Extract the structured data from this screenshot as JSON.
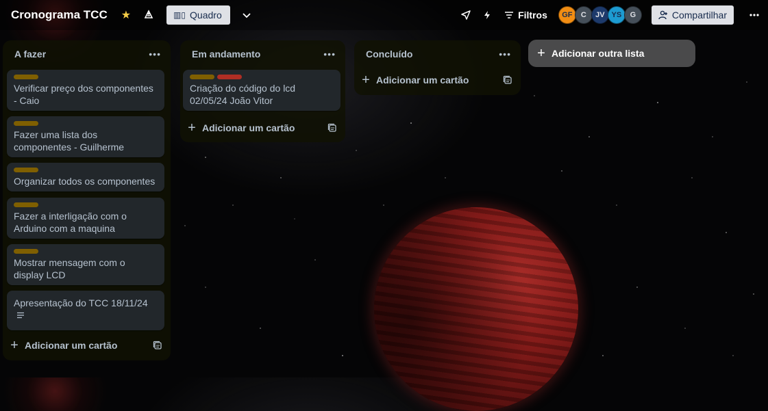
{
  "board": {
    "title": "Cronograma TCC",
    "view_label": "Quadro",
    "filter_label": "Filtros",
    "share_label": "Compartilhar"
  },
  "members": [
    {
      "initials": "GF",
      "bg": "#f18d13",
      "fg": "#172b4d"
    },
    {
      "initials": "C",
      "bg": "#454f59",
      "fg": "#dfe1e6"
    },
    {
      "initials": "JV",
      "bg": "#1d3a6b",
      "fg": "#dfe1e6"
    },
    {
      "initials": "YS",
      "bg": "#1d9bd1",
      "fg": "#172b4d"
    },
    {
      "initials": "G",
      "bg": "#454f59",
      "fg": "#dfe1e6"
    }
  ],
  "colors": {
    "label_yellow": "#7f5f01",
    "label_red": "#ae2e24",
    "star": "#f5cd47"
  },
  "lists": [
    {
      "title": "A fazer",
      "cards": [
        {
          "title": "Verificar preço dos componentes - Caio"
        },
        {
          "title": "Fazer uma lista dos componentes - Guilherme"
        },
        {
          "title": "Organizar todos os componentes"
        },
        {
          "title": "Fazer a interligação com o Arduino com a maquina"
        },
        {
          "title": "Mostrar mensagem com o display LCD"
        },
        {
          "title": "Apresentação do TCC 18/11/24"
        }
      ],
      "add_card_label": "Adicionar um cartão"
    },
    {
      "title": "Em andamento",
      "cards": [
        {
          "title": "Criação do código do lcd 02/05/24 João Vitor"
        }
      ],
      "add_card_label": "Adicionar um cartão"
    },
    {
      "title": "Concluído",
      "cards": [],
      "add_card_label": "Adicionar um cartão"
    }
  ],
  "add_list_label": "Adicionar outra lista"
}
